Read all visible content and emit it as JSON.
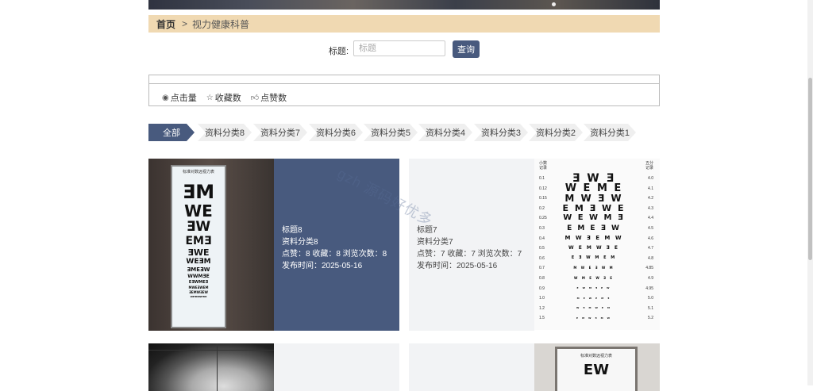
{
  "breadcrumb": {
    "home": "首页",
    "separator": ">",
    "current": "视力健康科普"
  },
  "search": {
    "label": "标题:",
    "placeholder": "标题",
    "button": "查询"
  },
  "sort": [
    {
      "icon": "eye-icon",
      "label": "点击量"
    },
    {
      "icon": "star-icon",
      "label": "收藏数"
    },
    {
      "icon": "thumbs-up-icon",
      "label": "点赞数"
    }
  ],
  "categories": [
    "全部",
    "资料分类8",
    "资料分类7",
    "资料分类6",
    "资料分类5",
    "资料分类4",
    "资料分类3",
    "资料分类2",
    "资料分类1"
  ],
  "cards": [
    {
      "title": "标题8",
      "category": "资料分类8",
      "stats": "点赞：8  收藏：8  浏览次数：8",
      "date": "发布时间：2025-05-16"
    },
    {
      "title": "标题7",
      "category": "资料分类7",
      "stats": "点赞：7  收藏：7  浏览次数：7",
      "date": "发布时间：2025-05-16"
    }
  ],
  "image_text": {
    "lightbox_header": "标准对数远视力表",
    "chart_header_left": "小数\n记录",
    "chart_header_right": "五分\n记录",
    "chart_decimal": [
      "0.1",
      "0.12",
      "0.15",
      "0.2",
      "0.25",
      "0.3",
      "0.4",
      "0.5",
      "0.6",
      "0.7",
      "0.8",
      "0.9",
      "1.0",
      "1.2",
      "1.5"
    ],
    "chart_five": [
      "4.0",
      "4.1",
      "4.2",
      "4.3",
      "4.4",
      "4.5",
      "4.6",
      "4.7",
      "4.8",
      "4.85",
      "4.9",
      "4.95",
      "5.0",
      "5.1",
      "5.2"
    ],
    "frame_header": "标准对数远视力表"
  },
  "watermark": "gzh 源码好优多",
  "colors": {
    "accent": "#485a7e",
    "breadcrumb_bg": "#f0d9b2",
    "card_info_bg": "#f2f3f5"
  }
}
